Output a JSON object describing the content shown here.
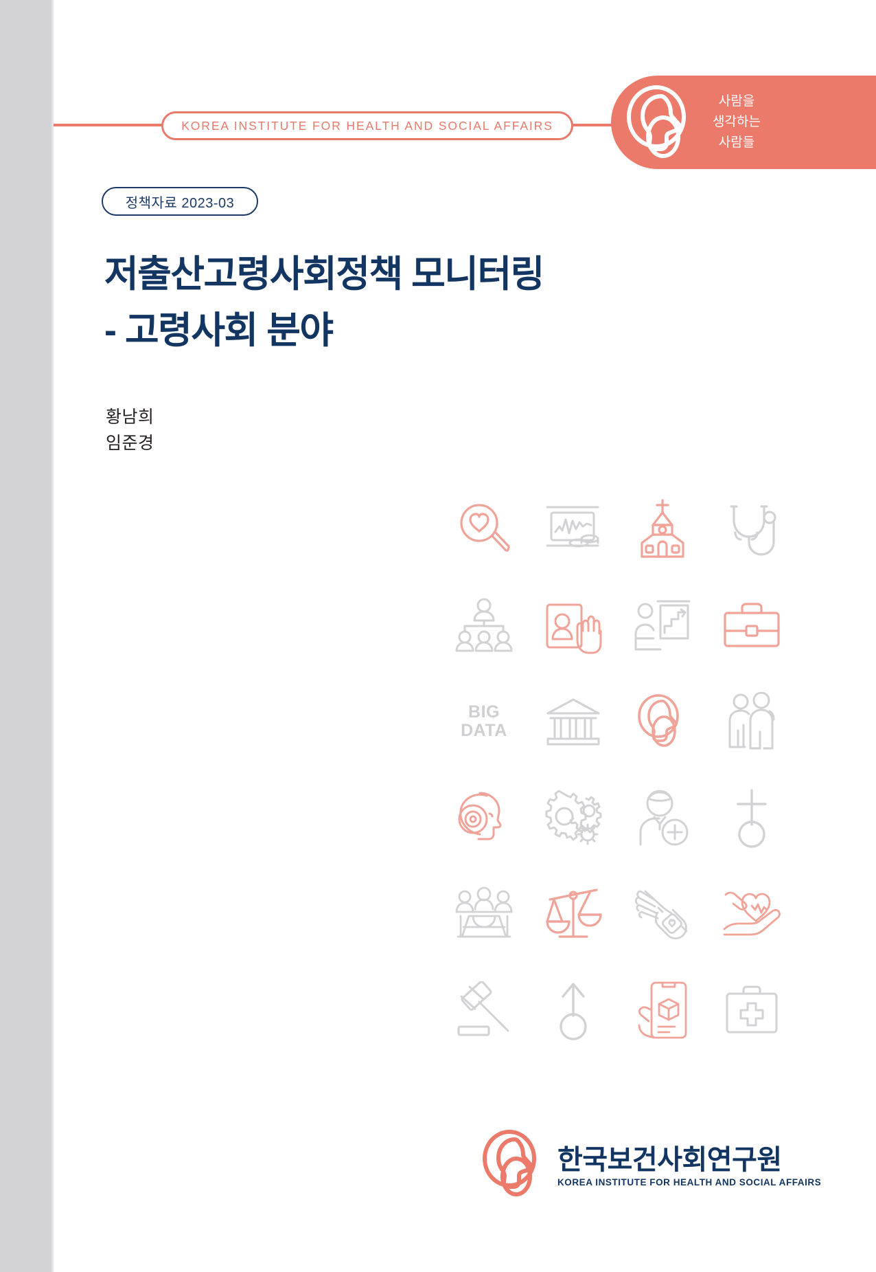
{
  "header": {
    "institute_pill": "KOREA INSTITUTE FOR HEALTH AND SOCIAL AFFAIRS",
    "tagline_line1": "사람을",
    "tagline_line2": "생각하는",
    "tagline_line3": "사람들",
    "head_icon": "head-profile-icon"
  },
  "report": {
    "series_badge": "정책자료 2023-03"
  },
  "title": {
    "line1": "저출산고령사회정책 모니터링",
    "line2": "- 고령사회 분야"
  },
  "authors": [
    {
      "name": "황남희"
    },
    {
      "name": "임준경"
    }
  ],
  "icon_grid": {
    "big_data_line1": "BIG",
    "big_data_line2": "DATA",
    "icons": [
      {
        "name": "heart-magnifier-icon",
        "color": "#f0a398"
      },
      {
        "name": "monitor-chart-coins-icon",
        "color": "#d2d2d5"
      },
      {
        "name": "church-icon",
        "color": "#f0a398"
      },
      {
        "name": "stethoscope-icon",
        "color": "#d2d2d5"
      },
      {
        "name": "people-org-chart-icon",
        "color": "#d2d2d5"
      },
      {
        "name": "id-card-hand-icon",
        "color": "#f0a398"
      },
      {
        "name": "presentation-growth-icon",
        "color": "#d2d2d5"
      },
      {
        "name": "briefcase-icon",
        "color": "#f0a398"
      },
      {
        "name": "big-data-text-icon",
        "color": "#cfcfd2"
      },
      {
        "name": "bank-building-icon",
        "color": "#d2d2d5"
      },
      {
        "name": "head-profile-icon",
        "color": "#f0a398"
      },
      {
        "name": "two-people-icon",
        "color": "#d2d2d5"
      },
      {
        "name": "head-target-icon",
        "color": "#f0a398"
      },
      {
        "name": "gears-icon",
        "color": "#d2d2d5"
      },
      {
        "name": "person-add-icon",
        "color": "#d2d2d5"
      },
      {
        "name": "female-gender-symbol-icon",
        "color": "#d2d2d5"
      },
      {
        "name": "conference-meeting-icon",
        "color": "#d2d2d5"
      },
      {
        "name": "justice-scales-icon",
        "color": "#f0a398"
      },
      {
        "name": "hand-smartwatch-icon",
        "color": "#d2d2d5"
      },
      {
        "name": "heart-in-hands-icon",
        "color": "#f0a398"
      },
      {
        "name": "gavel-icon",
        "color": "#d2d2d5"
      },
      {
        "name": "male-gender-symbol-icon",
        "color": "#d2d2d5"
      },
      {
        "name": "mobile-package-icon",
        "color": "#f0a398"
      },
      {
        "name": "first-aid-kit-icon",
        "color": "#d2d2d5"
      }
    ]
  },
  "footer": {
    "logo_kr": "한국보건사회연구원",
    "logo_en": "KOREA INSTITUTE FOR HEALTH AND SOCIAL AFFAIRS",
    "logo_mark": "head-profile-icon"
  },
  "colors": {
    "coral": "#ec7a6b",
    "coral_light": "#f0a398",
    "navy": "#123562",
    "navy_pill": "#1b3a68",
    "gray_icon": "#d2d2d5",
    "spine_gray": "#d3d3d7"
  }
}
